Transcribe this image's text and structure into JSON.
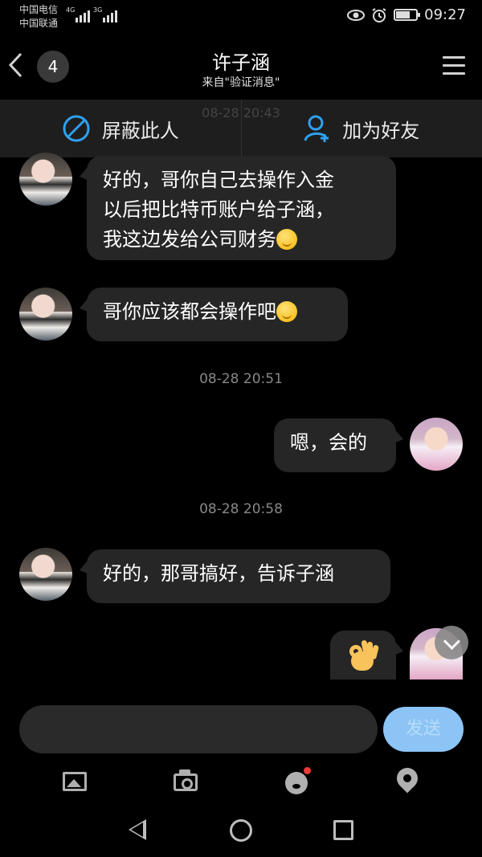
{
  "status_bar": {
    "carrier_1": "中国电信",
    "carrier_2": "中国联通",
    "network_1": "4G",
    "network_2": "3G",
    "time": "09:27",
    "battery_level": 0.7
  },
  "header": {
    "back_count": "4",
    "title": "许子涵",
    "subtitle": "来自\"验证消息\""
  },
  "action_bar": {
    "block_label": "屏蔽此人",
    "add_friend_label": "加为好友",
    "background_timestamp": "08-28 20:43"
  },
  "messages": [
    {
      "sender": "contact",
      "text": "好的，哥你自己去操作入金\n以后把比特币账户给子涵，\n我这边发给公司财务",
      "emoji": "smile-emoji"
    },
    {
      "sender": "contact",
      "text": "哥你应该都会操作吧",
      "emoji": "smile-emoji"
    },
    {
      "type": "timestamp",
      "text": "08-28 20:51"
    },
    {
      "sender": "self",
      "text": "嗯，会的"
    },
    {
      "type": "timestamp",
      "text": "08-28 20:58"
    },
    {
      "sender": "contact",
      "text": "好的，那哥搞好，告诉子涵"
    },
    {
      "sender": "self",
      "emoji": "ok-hand-emoji"
    }
  ],
  "input": {
    "value": "",
    "send_label": "发送"
  },
  "toolbar": {
    "icons": [
      "image-icon",
      "camera-icon",
      "sticker-icon",
      "location-icon"
    ]
  },
  "system_nav": {
    "icons": [
      "back-triangle-icon",
      "home-circle-icon",
      "recents-square-icon"
    ]
  }
}
